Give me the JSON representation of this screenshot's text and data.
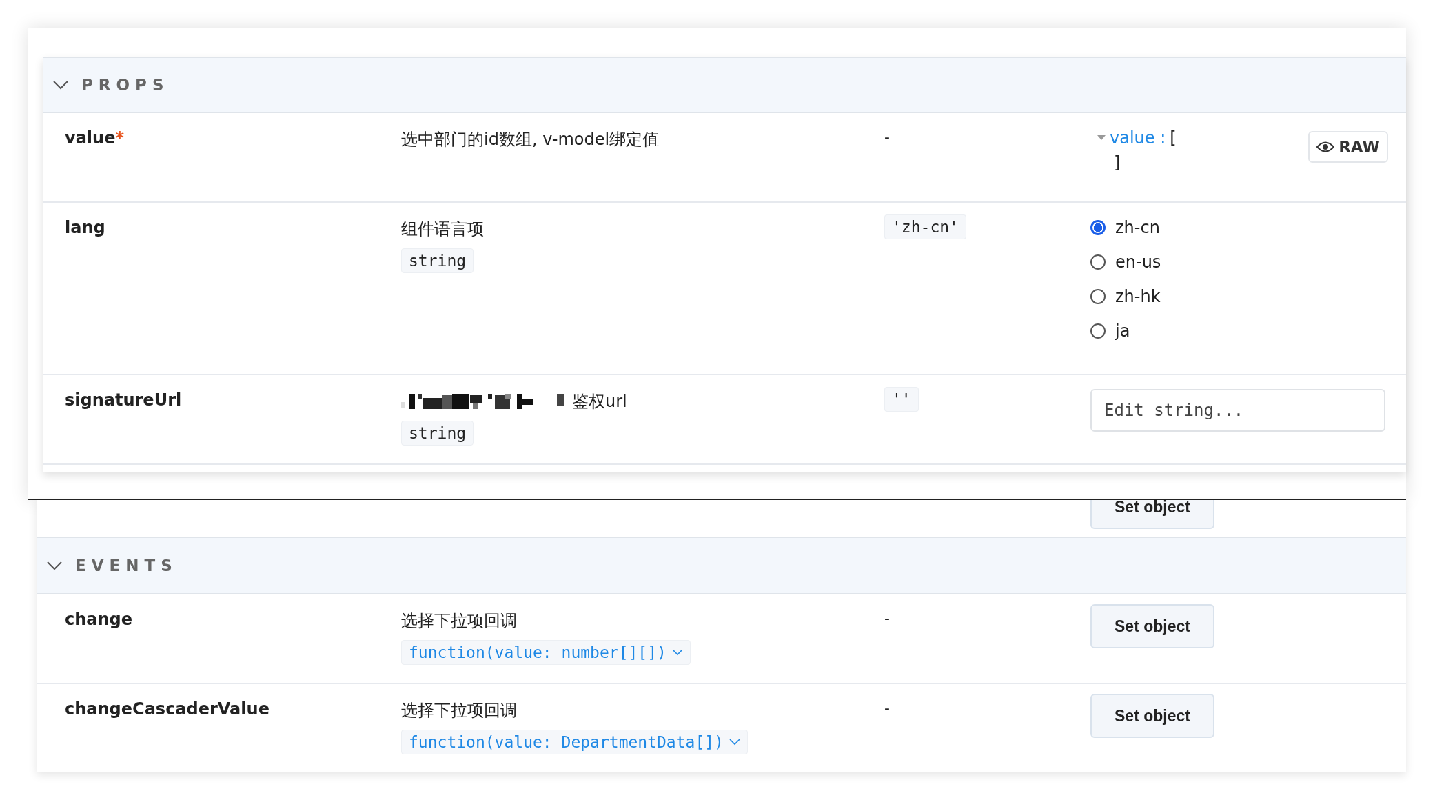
{
  "props_section": {
    "title": "PROPS",
    "expanded": true,
    "rows": [
      {
        "name": "value",
        "required_mark": "*",
        "description": "选中部门的id数组, v-model绑定值",
        "default": "-",
        "control": {
          "kind": "json",
          "key": "value :",
          "open": "[",
          "close": "]",
          "expanded": true,
          "raw_button": "RAW"
        }
      },
      {
        "name": "lang",
        "description": "组件语言项",
        "type": "string",
        "default": "'zh-cn'",
        "default_code": true,
        "control": {
          "kind": "radio",
          "options": [
            {
              "label": "zh-cn",
              "selected": true
            },
            {
              "label": "en-us",
              "selected": false
            },
            {
              "label": "zh-hk",
              "selected": false
            },
            {
              "label": "ja",
              "selected": false
            }
          ]
        }
      },
      {
        "name": "signatureUrl",
        "redacted": true,
        "description": "鉴权url",
        "type": "string",
        "default": "''",
        "default_code": true,
        "control": {
          "kind": "text",
          "placeholder": "Edit string..."
        }
      }
    ]
  },
  "covered_row": {
    "control": "Set object"
  },
  "events_section": {
    "title": "EVENTS",
    "expanded": true,
    "rows": [
      {
        "name": "change",
        "description": "选择下拉项回调",
        "type": "function(value: number[][])",
        "expandable": true,
        "default": "-",
        "control": "Set object"
      },
      {
        "name": "changeCascaderValue",
        "description": "选择下拉项回调",
        "type": "function(value: DepartmentData[])",
        "expandable": true,
        "default": "-",
        "control": "Set object"
      }
    ]
  }
}
